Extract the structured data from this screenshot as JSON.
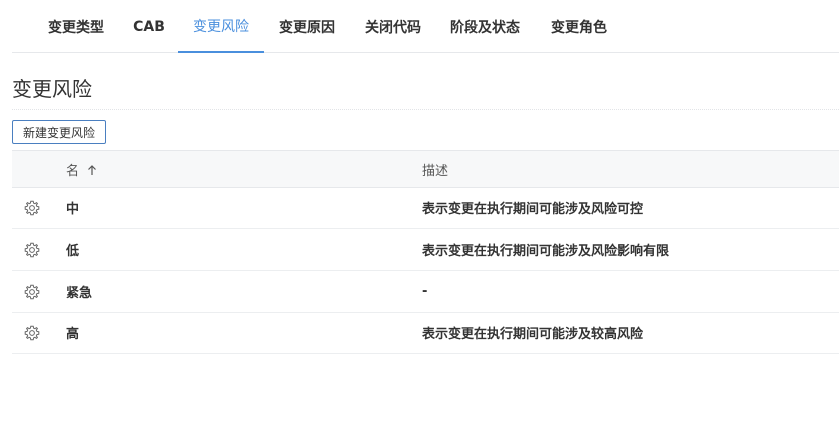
{
  "tabs": [
    {
      "label": "变更类型",
      "active": false
    },
    {
      "label": "CAB",
      "active": false
    },
    {
      "label": "变更风险",
      "active": true
    },
    {
      "label": "变更原因",
      "active": false
    },
    {
      "label": "关闭代码",
      "active": false
    },
    {
      "label": "阶段及状态",
      "active": false
    },
    {
      "label": "变更角色",
      "active": false
    }
  ],
  "page": {
    "title": "变更风险",
    "new_button_label": "新建变更风险"
  },
  "table": {
    "columns": {
      "name": "名",
      "name_sort_icon": "arrow-up-icon",
      "description": "描述"
    },
    "row_icon": "gear-icon",
    "rows": [
      {
        "name": "中",
        "description": "表示变更在执行期间可能涉及风险可控"
      },
      {
        "name": "低",
        "description": "表示变更在执行期间可能涉及风险影响有限"
      },
      {
        "name": "紧急",
        "description": "-"
      },
      {
        "name": "高",
        "description": "表示变更在执行期间可能涉及较高风险"
      }
    ]
  },
  "colors": {
    "accent": "#4a8fdd",
    "button_border": "#4a7fc0",
    "header_bg": "#f7f8f9"
  }
}
